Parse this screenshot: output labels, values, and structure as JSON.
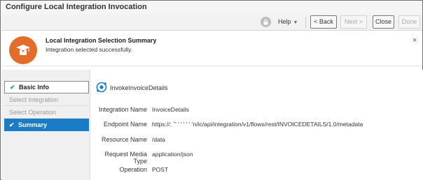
{
  "window": {
    "title": "Configure Local Integration Invocation"
  },
  "toolbar": {
    "help_label": "Help",
    "back_label": "< Back",
    "next_label": "Next >",
    "close_label": "Close",
    "done_label": "Done"
  },
  "banner": {
    "heading": "Local Integration Selection Summary",
    "message": "Integration selected successfully.",
    "close_glyph": "×"
  },
  "steps": [
    {
      "label": "Basic Info",
      "state": "complete"
    },
    {
      "label": "Select Integration",
      "state": "inactive"
    },
    {
      "label": "Select Operation",
      "state": "inactive"
    },
    {
      "label": "Summary",
      "state": "current"
    }
  ],
  "summary": {
    "flow_name": "InvokeInvoiceDetails",
    "fields": [
      {
        "label": "Integration Name",
        "value": "InvoiceDetails"
      },
      {
        "label": "Endpoint Name",
        "value": "https://: ˆ' '       ' ' ' ' 'n/ic/api/integration/v1/flows/rest/INVOICEDETAILS/1.0/metadata"
      },
      {
        "label": "Resource Name",
        "value": "/data"
      },
      {
        "label": "Request Media Type",
        "value": "application/json"
      },
      {
        "label": "Operation",
        "value": "POST"
      }
    ]
  },
  "colors": {
    "accent": "#1a7bc6",
    "badge": "#e26c28",
    "check": "#2ea34a"
  },
  "icons": {
    "badge": "graduate-icon",
    "flow": "integration-icon",
    "lock": "lock-icon"
  }
}
